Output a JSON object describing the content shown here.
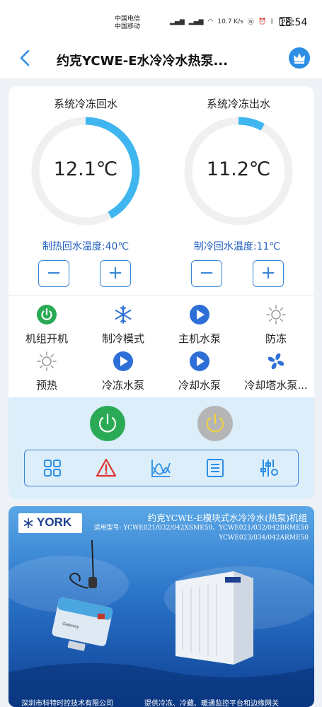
{
  "status_bar": {
    "carrier_1": "中国电信",
    "carrier_2": "中国移动",
    "net_speed": "10.7 K/s",
    "battery": "92",
    "time": "18:54"
  },
  "header": {
    "title": "约克YCWE-E水冷冷水热泵..."
  },
  "gauges": {
    "return": {
      "label": "系统冷冻回水",
      "value": "12.1℃",
      "fill": 0.42
    },
    "supply": {
      "label": "系统冷冻出水",
      "value": "11.2℃",
      "fill": 0.08
    }
  },
  "setpoints": {
    "heating": {
      "label": "制热回水温度:40℃",
      "minus": "−",
      "plus": "+"
    },
    "cooling": {
      "label": "制冷回水温度:11℃",
      "minus": "−",
      "plus": "+"
    }
  },
  "status_items": [
    {
      "label": "机组开机",
      "icon": "power-on-icon"
    },
    {
      "label": "制冷模式",
      "icon": "snowflake-icon"
    },
    {
      "label": "主机水泵",
      "icon": "play-pump-icon"
    },
    {
      "label": "防冻",
      "icon": "sun-icon"
    },
    {
      "label": "预热",
      "icon": "sun-icon"
    },
    {
      "label": "冷冻水泵",
      "icon": "play-pump-icon"
    },
    {
      "label": "冷却水泵",
      "icon": "play-pump-icon"
    },
    {
      "label": "冷却塔水泵...",
      "icon": "fan-icon"
    }
  ],
  "colors": {
    "accent_blue": "#2d6fd6",
    "gauge_track": "#f0f0f0",
    "gauge_fill": "#3fb6ef",
    "power_on": "#2aaa55",
    "power_off": "#b5b5b5",
    "alarm_red": "#e0322f"
  },
  "toolbar": [
    "grid-icon",
    "warning-icon",
    "trend-chart-icon",
    "list-icon",
    "settings-sliders-icon"
  ],
  "banner": {
    "brand": "YORK",
    "title": "约克YCWE-E模块式水冷冷水(热泵)机组",
    "models_line1": "适用型号: YCWE021/032/042XSME50、YCWE021/032/042BRME50",
    "models_line2": "YCWE023/034/042ARME50",
    "gateway_label": "Gateway",
    "company": "深圳市科特时控技术有限公司",
    "slogan": "提供冷冻、冷藏、暖通监控平台和边缘网关"
  }
}
